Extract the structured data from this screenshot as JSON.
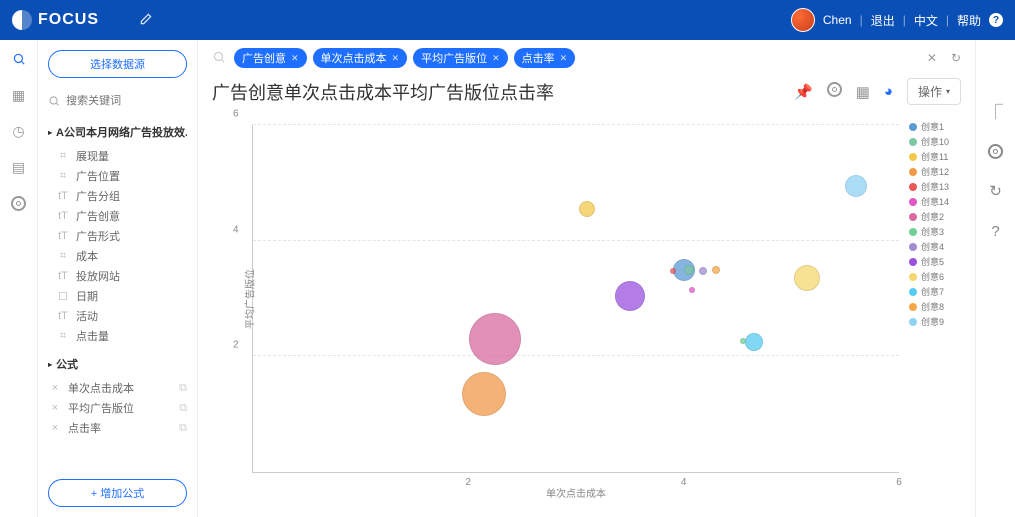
{
  "header": {
    "brand": "FOCUS",
    "user": "Chen",
    "logout": "退出",
    "lang": "中文",
    "help": "帮助"
  },
  "sidebar": {
    "select_source": "选择数据源",
    "search_placeholder": "搜索关键词",
    "tree_title": "A公司本月网络广告投放效...",
    "fields": [
      {
        "icon": "⌗",
        "label": "展现量"
      },
      {
        "icon": "⌗",
        "label": "广告位置"
      },
      {
        "icon": "tT",
        "label": "广告分组"
      },
      {
        "icon": "tT",
        "label": "广告创意"
      },
      {
        "icon": "tT",
        "label": "广告形式"
      },
      {
        "icon": "⌗",
        "label": "成本"
      },
      {
        "icon": "tT",
        "label": "投放网站"
      },
      {
        "icon": "☐",
        "label": "日期"
      },
      {
        "icon": "tT",
        "label": "活动"
      },
      {
        "icon": "⌗",
        "label": "点击量"
      }
    ],
    "formula_head": "公式",
    "formulas": [
      "单次点击成本",
      "平均广告版位",
      "点击率"
    ],
    "add_formula": "+ 增加公式"
  },
  "query": {
    "pills": [
      "广告创意",
      "单次点击成本",
      "平均广告版位",
      "点击率"
    ]
  },
  "title": {
    "chart_title": "广告创意单次点击成本平均广告版位点击率",
    "ops": "操作"
  },
  "chart_data": {
    "type": "scatter",
    "xlabel": "单次点击成本",
    "ylabel": "平均广告版位",
    "xlim": [
      0,
      6
    ],
    "ylim": [
      0,
      6
    ],
    "xticks": [
      2,
      4,
      6
    ],
    "yticks": [
      2,
      4,
      6
    ],
    "series": [
      {
        "name": "创意1",
        "color": "#5b9bd5",
        "x": 4.0,
        "y": 3.5,
        "r": 11
      },
      {
        "name": "创意10",
        "color": "#7cc7a6",
        "x": 4.05,
        "y": 3.5,
        "r": 5
      },
      {
        "name": "创意11",
        "color": "#f2c94c",
        "x": 3.1,
        "y": 4.55,
        "r": 8
      },
      {
        "name": "创意12",
        "color": "#f2994a",
        "x": 2.15,
        "y": 1.35,
        "r": 22
      },
      {
        "name": "创意13",
        "color": "#eb5757",
        "x": 3.9,
        "y": 3.48,
        "r": 3
      },
      {
        "name": "创意14",
        "color": "#e056c4",
        "x": 4.08,
        "y": 3.15,
        "r": 3
      },
      {
        "name": "创意2",
        "color": "#d96ba0",
        "x": 2.25,
        "y": 2.3,
        "r": 26
      },
      {
        "name": "创意3",
        "color": "#6fcf97",
        "x": 4.55,
        "y": 2.27,
        "r": 3
      },
      {
        "name": "创意4",
        "color": "#a18cd1",
        "x": 4.18,
        "y": 3.47,
        "r": 4
      },
      {
        "name": "创意5",
        "color": "#9b51e0",
        "x": 3.5,
        "y": 3.05,
        "r": 15
      },
      {
        "name": "创意6",
        "color": "#f5d76e",
        "x": 5.15,
        "y": 3.35,
        "r": 13
      },
      {
        "name": "创意7",
        "color": "#56ccf2",
        "x": 4.65,
        "y": 2.25,
        "r": 9
      },
      {
        "name": "创意8",
        "color": "#f7a64a",
        "x": 4.3,
        "y": 3.5,
        "r": 4
      },
      {
        "name": "创意9",
        "color": "#8fd3f4",
        "x": 5.6,
        "y": 4.95,
        "r": 11
      }
    ]
  }
}
